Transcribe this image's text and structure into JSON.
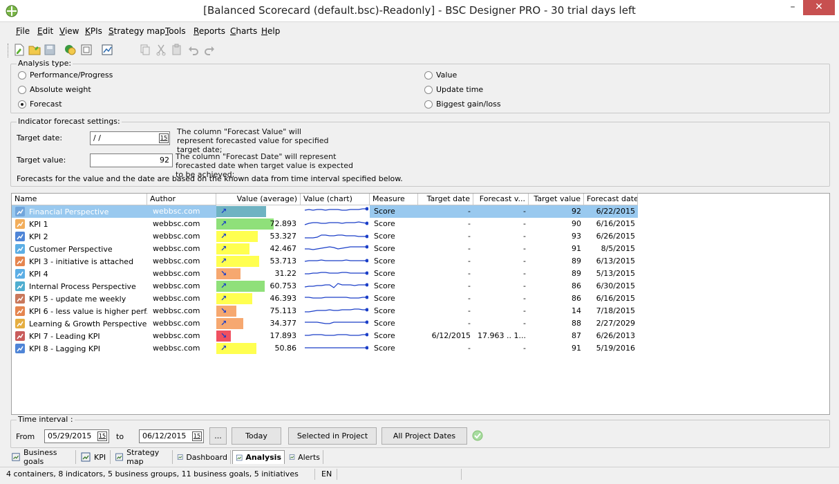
{
  "window": {
    "title": "[Balanced Scorecard (default.bsc)-Readonly] - BSC Designer PRO - 30 trial days left",
    "minimize": "–",
    "close": "✕"
  },
  "menu": [
    "File",
    "Edit",
    "View",
    "KPIs",
    "Strategy map",
    "Tools",
    "Reports",
    "Charts",
    "Help"
  ],
  "analysis": {
    "legend": "Analysis type:",
    "options": [
      {
        "label": "Performance/Progress",
        "checked": false
      },
      {
        "label": "Absolute weight",
        "checked": false
      },
      {
        "label": "Forecast",
        "checked": true
      },
      {
        "label": "Value",
        "checked": false
      },
      {
        "label": "Update time",
        "checked": false
      },
      {
        "label": "Biggest gain/loss",
        "checked": false
      }
    ]
  },
  "forecast": {
    "legend": "Indicator forecast settings:",
    "target_date_label": "Target date:",
    "target_date_value": " / /",
    "target_date_hint": "The column \"Forecast Value\" will represent forecasted value for specified target date;",
    "target_value_label": "Target value:",
    "target_value_value": "92",
    "target_value_hint": "The column \"Forecast Date\" will represent forecasted date when target value is expected to be achieved;",
    "note": "Forecasts for the value and the date are based on the known data from time interval specified below.",
    "calendar_glyph": "15"
  },
  "grid": {
    "columns": [
      "Name",
      "Author",
      "Value (average)",
      "Value (chart)",
      "Measure",
      "Target date",
      "Forecast v...",
      "Target value",
      "Forecast date"
    ],
    "rows": [
      {
        "name": "Financial Perspective",
        "author": "webbsc.com",
        "value": "63.11",
        "progress": 0.63,
        "bar_color": "#6fb3c2",
        "trend": "up",
        "measure": "Score",
        "target_date": "-",
        "forecast_value": "-",
        "target_value": "92",
        "forecast_date": "6/22/2015",
        "icon": "perspective-icon",
        "icon_color": "#6aa0d8",
        "spark": [
          6,
          5,
          6,
          5,
          5,
          6,
          5,
          5,
          5,
          6,
          6,
          5,
          5,
          5,
          4,
          4
        ],
        "selected": true
      },
      {
        "name": "KPI 1",
        "author": "webbsc.com",
        "value": "72.893",
        "progress": 0.73,
        "bar_color": "#8fe07a",
        "trend": "up",
        "measure": "Score",
        "target_date": "-",
        "forecast_value": "-",
        "target_value": "90",
        "forecast_date": "6/16/2015",
        "icon": "kpi-icon",
        "icon_color": "#f0a040",
        "spark": [
          9,
          7,
          6,
          6,
          7,
          7,
          6,
          6,
          6,
          7,
          6,
          6,
          6,
          5,
          6,
          7
        ],
        "selected": false
      },
      {
        "name": "KPI 2",
        "author": "webbsc.com",
        "value": "53.327",
        "progress": 0.53,
        "bar_color": "#ffff50",
        "trend": "up",
        "measure": "Score",
        "target_date": "-",
        "forecast_value": "-",
        "target_value": "93",
        "forecast_date": "6/26/2015",
        "icon": "kpi-chart-icon",
        "icon_color": "#3070d0",
        "spark": [
          10,
          10,
          10,
          9,
          6,
          6,
          7,
          7,
          6,
          6,
          7,
          7,
          7,
          8,
          8,
          8
        ],
        "selected": false
      },
      {
        "name": "Customer Perspective",
        "author": "webbsc.com",
        "value": "42.467",
        "progress": 0.42,
        "bar_color": "#ffff50",
        "trend": "up",
        "measure": "Score",
        "target_date": "-",
        "forecast_value": "-",
        "target_value": "91",
        "forecast_date": "8/5/2015",
        "icon": "customer-icon",
        "icon_color": "#3fa0e0",
        "spark": [
          8,
          8,
          9,
          8,
          7,
          6,
          5,
          6,
          8,
          7,
          6,
          5,
          5,
          5,
          5,
          5
        ],
        "selected": false
      },
      {
        "name": "KPI 3 - initiative is attached",
        "author": "webbsc.com",
        "value": "53.713",
        "progress": 0.54,
        "bar_color": "#ffff50",
        "trend": "up",
        "measure": "Score",
        "target_date": "-",
        "forecast_value": "-",
        "target_value": "89",
        "forecast_date": "6/13/2015",
        "icon": "initiative-icon",
        "icon_color": "#e07030",
        "spark": [
          8,
          7,
          7,
          7,
          6,
          7,
          7,
          7,
          7,
          7,
          6,
          7,
          7,
          7,
          7,
          7
        ],
        "selected": false
      },
      {
        "name": "KPI 4",
        "author": "webbsc.com",
        "value": "31.22",
        "progress": 0.31,
        "bar_color": "#f6a870",
        "trend": "down",
        "measure": "Score",
        "target_date": "-",
        "forecast_value": "-",
        "target_value": "89",
        "forecast_date": "5/13/2015",
        "icon": "kpi-people-icon",
        "icon_color": "#3fa0e0",
        "spark": [
          8,
          8,
          7,
          7,
          6,
          6,
          7,
          7,
          7,
          6,
          6,
          7,
          7,
          7,
          7,
          7
        ],
        "selected": false
      },
      {
        "name": "Internal Process Perspective",
        "author": "webbsc.com",
        "value": "60.753",
        "progress": 0.61,
        "bar_color": "#8fe07a",
        "trend": "up",
        "measure": "Score",
        "target_date": "-",
        "forecast_value": "-",
        "target_value": "86",
        "forecast_date": "6/30/2015",
        "icon": "process-icon",
        "icon_color": "#30a0c8",
        "spark": [
          9,
          8,
          8,
          7,
          7,
          6,
          6,
          10,
          4,
          6,
          6,
          6,
          7,
          6,
          6,
          6
        ],
        "selected": false
      },
      {
        "name": "KPI 5 - update me weekly",
        "author": "webbsc.com",
        "value": "46.393",
        "progress": 0.46,
        "bar_color": "#ffff50",
        "trend": "up",
        "measure": "Score",
        "target_date": "-",
        "forecast_value": "-",
        "target_value": "86",
        "forecast_date": "6/16/2015",
        "icon": "clock-icon",
        "icon_color": "#c06040",
        "spark": [
          6,
          6,
          7,
          7,
          7,
          6,
          6,
          6,
          6,
          6,
          6,
          7,
          7,
          7,
          6,
          6
        ],
        "selected": false
      },
      {
        "name": "KPI 6 - less value is higher perf...",
        "author": "webbsc.com",
        "value": "75.113",
        "progress": 0.25,
        "bar_color": "#f6a870",
        "trend": "down",
        "measure": "Score",
        "target_date": "-",
        "forecast_value": "-",
        "target_value": "14",
        "forecast_date": "7/18/2015",
        "icon": "kpi-warning-icon",
        "icon_color": "#e07030",
        "spark": [
          9,
          9,
          8,
          7,
          7,
          7,
          6,
          7,
          7,
          6,
          6,
          6,
          5,
          5,
          6,
          6
        ],
        "selected": false
      },
      {
        "name": "Learning & Growth Perspective",
        "author": "webbsc.com",
        "value": "34.377",
        "progress": 0.34,
        "bar_color": "#f6a870",
        "trend": "up",
        "measure": "Score",
        "target_date": "-",
        "forecast_value": "-",
        "target_value": "88",
        "forecast_date": "2/27/2029",
        "icon": "learning-icon",
        "icon_color": "#e0a020",
        "spark": [
          6,
          6,
          6,
          6,
          7,
          8,
          8,
          6,
          6,
          6,
          6,
          6,
          6,
          6,
          6,
          6
        ],
        "selected": false
      },
      {
        "name": "KPI 7 - Leading KPI",
        "author": "webbsc.com",
        "value": "17.893",
        "progress": 0.18,
        "bar_color": "#f05060",
        "trend": "down",
        "measure": "Score",
        "target_date": "6/12/2015",
        "forecast_value": "17.963 .. 1...",
        "target_value": "87",
        "forecast_date": "6/26/2013",
        "icon": "leading-kpi-icon",
        "icon_color": "#c04040",
        "spark": [
          7,
          7,
          6,
          6,
          6,
          7,
          7,
          7,
          6,
          6,
          6,
          7,
          7,
          7,
          6,
          6
        ],
        "selected": false
      },
      {
        "name": "KPI 8 - Lagging KPI",
        "author": "webbsc.com",
        "value": "50.86",
        "progress": 0.51,
        "bar_color": "#ffff50",
        "trend": "up",
        "measure": "Score",
        "target_date": "-",
        "forecast_value": "-",
        "target_value": "91",
        "forecast_date": "5/19/2016",
        "icon": "lagging-kpi-icon",
        "icon_color": "#3070d0",
        "spark": [
          7,
          7,
          7,
          7,
          7,
          7,
          7,
          7,
          7,
          7,
          7,
          7,
          7,
          7,
          7,
          7
        ],
        "selected": false
      }
    ]
  },
  "interval": {
    "legend": "Time interval :",
    "from_label": "From",
    "from_value": "05/29/2015",
    "to_label": "to",
    "to_value": "06/12/2015",
    "ellipsis": "...",
    "today": "Today",
    "selected_in_project": "Selected in Project",
    "all_project_dates": "All Project Dates"
  },
  "tabs": [
    {
      "label": "Business goals",
      "icon": "goals-icon",
      "active": false
    },
    {
      "label": "KPI",
      "icon": "kpi-list-icon",
      "active": false
    },
    {
      "label": "Strategy map",
      "icon": "strategy-map-icon",
      "active": false
    },
    {
      "label": "Dashboard",
      "icon": "dashboard-icon",
      "active": false
    },
    {
      "label": "Analysis",
      "icon": "analysis-icon",
      "active": true
    },
    {
      "label": "Alerts",
      "icon": "alerts-icon",
      "active": false
    }
  ],
  "status": {
    "summary": "4 containers, 8 indicators, 5 business groups, 11 business goals, 5 initiatives",
    "lang": "EN"
  },
  "colors": {
    "selection": "#99c9ef",
    "spark": "#1a3ec8"
  }
}
